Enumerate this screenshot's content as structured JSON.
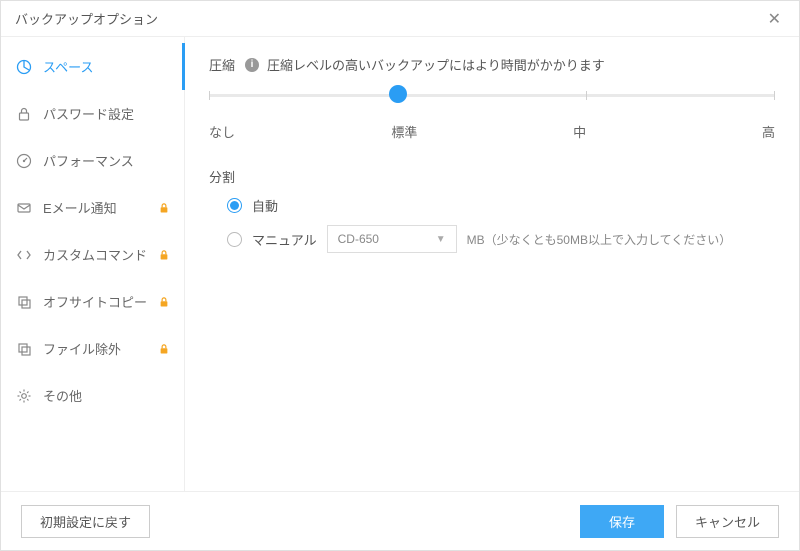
{
  "window": {
    "title": "バックアップオプション"
  },
  "sidebar": {
    "items": [
      {
        "label": "スペース",
        "locked": false
      },
      {
        "label": "パスワード設定",
        "locked": false
      },
      {
        "label": "パフォーマンス",
        "locked": false
      },
      {
        "label": "Eメール通知",
        "locked": true
      },
      {
        "label": "カスタムコマンド",
        "locked": true
      },
      {
        "label": "オフサイトコピー",
        "locked": true
      },
      {
        "label": "ファイル除外",
        "locked": true
      },
      {
        "label": "その他",
        "locked": false
      }
    ]
  },
  "compress": {
    "label": "圧縮",
    "hint": "圧縮レベルの高いバックアップにはより時間がかかります",
    "levels": {
      "none": "なし",
      "normal": "標準",
      "medium": "中",
      "high": "高"
    },
    "value_index": 1
  },
  "split": {
    "label": "分割",
    "auto": "自動",
    "manual": "マニュアル",
    "selected": "auto",
    "dropdown_value": "CD-650",
    "unit_hint": "MB（少なくとも50MB以上で入力してください）"
  },
  "footer": {
    "reset": "初期設定に戻す",
    "save": "保存",
    "cancel": "キャンセル"
  }
}
